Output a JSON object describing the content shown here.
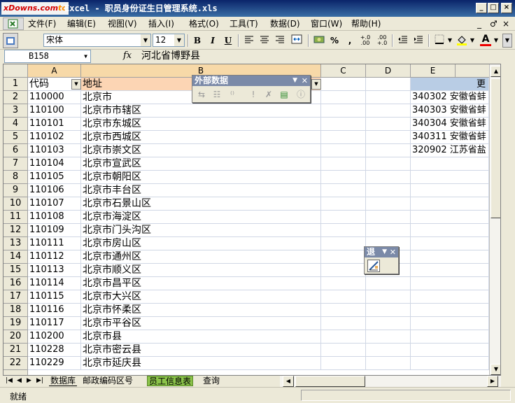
{
  "window": {
    "logo_text": "xDowns.com",
    "logo_suffix": "tc",
    "title": "Excel - 职员身份证生日管理系统.xls",
    "buttons": [
      "_",
      "□",
      "×"
    ]
  },
  "menu": [
    "文件(F)",
    "编辑(E)",
    "视图(V)",
    "插入(I)",
    "格式(O)",
    "工具(T)",
    "数据(D)",
    "窗口(W)",
    "帮助(H)"
  ],
  "menu_right": [
    "_",
    "♂",
    "×"
  ],
  "toolbar": {
    "font_name": "宋体",
    "font_size": "12",
    "bold": "B",
    "italic": "I",
    "underline": "U",
    "percent": "%",
    "comma": ",",
    "inc_decimal": "+.0\n.00",
    "dec_decimal": ".00\n+.0"
  },
  "formula_bar": {
    "name_box": "B158",
    "fx": "fx",
    "value": "河北省博野县"
  },
  "columns": [
    "A",
    "B",
    "C",
    "D",
    "E"
  ],
  "headers": {
    "A1": "代码",
    "B1": "地址",
    "F1": "更"
  },
  "rows": [
    {
      "n": "1",
      "a": "代码",
      "b": "地址",
      "e": ""
    },
    {
      "n": "2",
      "a": "110000",
      "b": "北京市",
      "e": "340302 安徽省蚌"
    },
    {
      "n": "3",
      "a": "110100",
      "b": "北京市市辖区",
      "e": "340303 安徽省蚌"
    },
    {
      "n": "4",
      "a": "110101",
      "b": "北京市东城区",
      "e": "340304 安徽省蚌"
    },
    {
      "n": "5",
      "a": "110102",
      "b": "北京市西城区",
      "e": "340311 安徽省蚌"
    },
    {
      "n": "6",
      "a": "110103",
      "b": "北京市崇文区",
      "e": "320902 江苏省盐"
    },
    {
      "n": "7",
      "a": "110104",
      "b": "北京市宣武区",
      "e": ""
    },
    {
      "n": "8",
      "a": "110105",
      "b": "北京市朝阳区",
      "e": ""
    },
    {
      "n": "9",
      "a": "110106",
      "b": "北京市丰台区",
      "e": ""
    },
    {
      "n": "10",
      "a": "110107",
      "b": "北京市石景山区",
      "e": ""
    },
    {
      "n": "11",
      "a": "110108",
      "b": "北京市海淀区",
      "e": ""
    },
    {
      "n": "12",
      "a": "110109",
      "b": "北京市门头沟区",
      "e": ""
    },
    {
      "n": "13",
      "a": "110111",
      "b": "北京市房山区",
      "e": ""
    },
    {
      "n": "14",
      "a": "110112",
      "b": "北京市通州区",
      "e": ""
    },
    {
      "n": "15",
      "a": "110113",
      "b": "北京市顺义区",
      "e": ""
    },
    {
      "n": "16",
      "a": "110114",
      "b": "北京市昌平区",
      "e": ""
    },
    {
      "n": "17",
      "a": "110115",
      "b": "北京市大兴区",
      "e": ""
    },
    {
      "n": "18",
      "a": "110116",
      "b": "北京市怀柔区",
      "e": ""
    },
    {
      "n": "19",
      "a": "110117",
      "b": "北京市平谷区",
      "e": ""
    },
    {
      "n": "20",
      "a": "110200",
      "b": "北京市县",
      "e": ""
    },
    {
      "n": "21",
      "a": "110228",
      "b": "北京市密云县",
      "e": ""
    },
    {
      "n": "22",
      "a": "110229",
      "b": "北京市延庆县",
      "e": ""
    }
  ],
  "external_data_toolbar": {
    "title": "外部数据"
  },
  "exit_toolbar": {
    "title": "退"
  },
  "sheet_tabs": [
    "数据库",
    "邮政编码区号",
    "员工信息表",
    "查询"
  ],
  "active_tab": "员工信息表",
  "status": "就绪",
  "colors": {
    "header_fill_b": "#fcd5b4",
    "header_fill_f": "#b9cde5",
    "title_gradient_start": "#0a246a"
  }
}
